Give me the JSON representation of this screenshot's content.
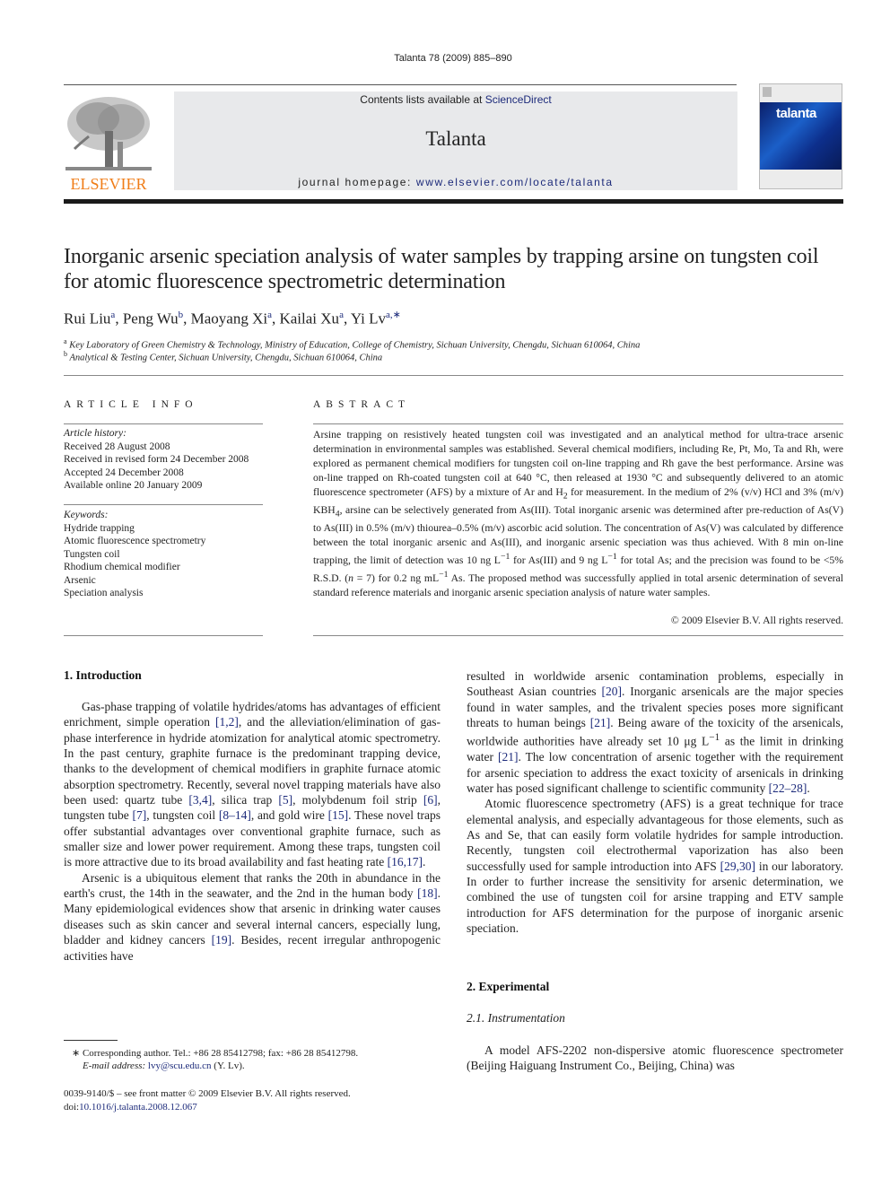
{
  "header": {
    "journal_ref": "Talanta 78 (2009) 885–890",
    "contents_prefix": "Contents lists available at ",
    "contents_link": "ScienceDirect",
    "journal_name": "Talanta",
    "homepage_prefix": "journal homepage: ",
    "homepage_link": "www.elsevier.com/locate/talanta",
    "publisher_logo_text": "ELSEVIER",
    "cover_title": "talanta",
    "colors": {
      "publisher_orange": "#f07d18",
      "link_blue": "#1c2a7a",
      "masthead_gray": "#e8e9eb"
    }
  },
  "article": {
    "title": "Inorganic arsenic speciation analysis of water samples by trapping arsine on tungsten coil for atomic fluorescence spectrometric determination",
    "authors": [
      {
        "name": "Rui Liu",
        "aff": "a"
      },
      {
        "name": "Peng Wu",
        "aff": "b"
      },
      {
        "name": "Maoyang Xi",
        "aff": "a"
      },
      {
        "name": "Kailai Xu",
        "aff": "a"
      },
      {
        "name": "Yi Lv",
        "aff": "a,∗"
      }
    ],
    "affiliations": [
      {
        "mark": "a",
        "text": "Key Laboratory of Green Chemistry & Technology, Ministry of Education, College of Chemistry, Sichuan University, Chengdu, Sichuan 610064, China"
      },
      {
        "mark": "b",
        "text": "Analytical & Testing Center, Sichuan University, Chengdu, Sichuan 610064, China"
      }
    ]
  },
  "article_info": {
    "heading": "ARTICLE INFO",
    "history_label": "Article history:",
    "history": [
      "Received 28 August 2008",
      "Received in revised form 24 December 2008",
      "Accepted 24 December 2008",
      "Available online 20 January 2009"
    ],
    "keywords_label": "Keywords:",
    "keywords": [
      "Hydride trapping",
      "Atomic fluorescence spectrometry",
      "Tungsten coil",
      "Rhodium chemical modifier",
      "Arsenic",
      "Speciation analysis"
    ]
  },
  "abstract": {
    "heading": "ABSTRACT",
    "parts": {
      "p1": "Arsine trapping on resistively heated tungsten coil was investigated and an analytical method for ultra-trace arsenic determination in environmental samples was established. Several chemical modifiers, including Re, Pt, Mo, Ta and Rh, were explored as permanent chemical modifiers for tungsten coil on-line trapping and Rh gave the best performance. Arsine was on-line trapped on Rh-coated tungsten coil at 640 °C, then released at 1930 °C and subsequently delivered to an atomic fluorescence spectrometer (AFS) by a mixture of Ar and H",
      "sub_h2": "2",
      "p2": " for measurement. In the medium of 2% (v/v) HCl and 3% (m/v) KBH",
      "sub_kbh4": "4",
      "p3": ", arsine can be selectively generated from As(III). Total inorganic arsenic was determined after pre-reduction of As(V) to As(III) in 0.5% (m/v) thiourea–0.5% (m/v) ascorbic acid solution. The concentration of As(V) was calculated by difference between the total inorganic arsenic and As(III), and inorganic arsenic speciation was thus achieved. With 8 min on-line trapping, the limit of detection was 10 ng L",
      "sup1": "−1",
      "p4": " for As(III) and 9 ng L",
      "sup2": "−1",
      "p5": " for total As; and the precision was found to be <5% R.S.D. (",
      "n_italic": "n",
      "p6": " = 7) for 0.2 ng mL",
      "sup3": "−1",
      "p7": " As. The proposed method was successfully applied in total arsenic determination of several standard reference materials and inorganic arsenic speciation analysis of nature water samples."
    },
    "copyright": "© 2009 Elsevier B.V. All rights reserved."
  },
  "sections": {
    "intro_heading": "1.  Introduction",
    "intro_p1": {
      "a": "Gas-phase trapping of volatile hydrides/atoms has advantages of efficient enrichment, simple operation ",
      "c1": "[1,2]",
      "b": ", and the alleviation/elimination of gas-phase interference in hydride atomization for analytical atomic spectrometry. In the past century, graphite furnace is the predominant trapping device, thanks to the development of chemical modifiers in graphite furnace atomic absorption spectrometry. Recently, several novel trapping materials have also been used: quartz tube ",
      "c2": "[3,4]",
      "c": ", silica trap ",
      "c3": "[5]",
      "d": ", molybdenum foil strip ",
      "c4": "[6]",
      "e": ", tungsten tube ",
      "c5": "[7]",
      "f": ", tungsten coil ",
      "c6": "[8–14]",
      "g": ", and gold wire ",
      "c7": "[15]",
      "h": ". These novel traps offer substantial advantages over conventional graphite furnace, such as smaller size and lower power requirement. Among these traps, tungsten coil is more attractive due to its broad availability and fast heating rate ",
      "c8": "[16,17]",
      "i": "."
    },
    "intro_p2": {
      "a": "Arsenic is a ubiquitous element that ranks the 20th in abundance in the earth's crust, the 14th in the seawater, and the 2nd in the human body ",
      "c1": "[18]",
      "b": ". Many epidemiological evidences show that arsenic in drinking water causes diseases such as skin cancer and several internal cancers, especially lung, bladder and kidney cancers ",
      "c2": "[19]",
      "c": ". Besides, recent irregular anthropogenic activities have "
    },
    "right_p1": {
      "a": "resulted in worldwide arsenic contamination problems, especially in Southeast Asian countries ",
      "c1": "[20]",
      "b": ". Inorganic arsenicals are the major species found in water samples, and the trivalent species poses more significant threats to human beings ",
      "c2": "[21]",
      "c": ". Being aware of the toxicity of the arsenicals, worldwide authorities have already set 10 μg L",
      "sup": "−1",
      "d": " as the limit in drinking water ",
      "c3": "[21]",
      "e": ". The low concentration of arsenic together with the requirement for arsenic speciation to address the exact toxicity of arsenicals in drinking water has posed significant challenge to scientific community ",
      "c4": "[22–28]",
      "f": "."
    },
    "right_p2": {
      "a": "Atomic fluorescence spectrometry (AFS) is a great technique for trace elemental analysis, and especially advantageous for those elements, such as As and Se, that can easily form volatile hydrides for sample introduction. Recently, tungsten coil electrothermal vaporization has also been successfully used for sample introduction into AFS ",
      "c1": "[29,30]",
      "b": " in our laboratory. In order to further increase the sensitivity for arsenic determination, we combined the use of tungsten coil for arsine trapping and ETV sample introduction for AFS determination for the purpose of inorganic arsenic speciation."
    },
    "experimental_heading": "2.  Experimental",
    "instrumentation_heading": "2.1.  Instrumentation",
    "instr_p1": "A model AFS-2202 non-dispersive atomic fluorescence spectrometer (Beijing Haiguang Instrument Co., Beijing, China) was"
  },
  "footnotes": {
    "mark": "∗",
    "corresponding": " Corresponding author. Tel.: +86 28 85412798; fax: +86 28 85412798.",
    "email_label": "E-mail address: ",
    "email": "lvy@scu.edu.cn",
    "email_suffix": " (Y. Lv).",
    "issn_line": "0039-9140/$ – see front matter © 2009 Elsevier B.V. All rights reserved.",
    "doi_label": "doi:",
    "doi": "10.1016/j.talanta.2008.12.067"
  }
}
